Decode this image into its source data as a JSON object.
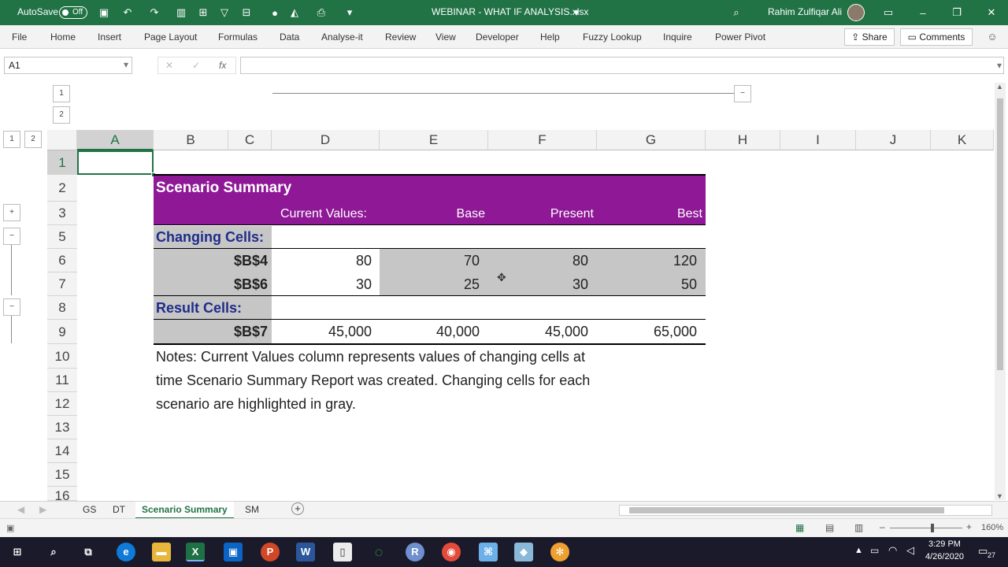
{
  "titlebar": {
    "autosave_label": "AutoSave",
    "autosave_state": "Off",
    "file_name": "WEBINAR - WHAT IF ANALYSIS.xlsx",
    "user_name": "Rahim Zulfiqar Ali"
  },
  "ribbon": {
    "tabs": [
      "File",
      "Home",
      "Insert",
      "Page Layout",
      "Formulas",
      "Data",
      "Analyse-it",
      "Review",
      "View",
      "Developer",
      "Help",
      "Fuzzy Lookup",
      "Inquire",
      "Power Pivot"
    ],
    "share": "Share",
    "comments": "Comments"
  },
  "formula_bar": {
    "name_box": "A1",
    "fx": "fx",
    "formula": ""
  },
  "outline": {
    "row_levels": [
      "1",
      "2"
    ],
    "col_levels": [
      "1",
      "2"
    ],
    "collapse_symbol": "−",
    "expand_symbol": "+"
  },
  "grid": {
    "columns": [
      "A",
      "B",
      "C",
      "D",
      "E",
      "F",
      "G",
      "H",
      "I",
      "J",
      "K"
    ],
    "rows": [
      "1",
      "2",
      "3",
      "5",
      "6",
      "7",
      "8",
      "9",
      "10",
      "11",
      "12",
      "13",
      "14",
      "15",
      "16"
    ]
  },
  "report": {
    "title": "Scenario Summary",
    "header_current": "Current Values:",
    "header_base": "Base",
    "header_present": "Present",
    "header_best": "Best",
    "changing_label": "Changing Cells:",
    "result_label": "Result Cells:",
    "row_b4": {
      "name": "$B$4",
      "current": "80",
      "base": "70",
      "present": "80",
      "best": "120"
    },
    "row_b6": {
      "name": "$B$6",
      "current": "30",
      "base": "25",
      "present": "30",
      "best": "50"
    },
    "row_b7": {
      "name": "$B$7",
      "current": "45,000",
      "base": "40,000",
      "present": "45,000",
      "best": "65,000"
    },
    "notes_line1": "Notes:  Current Values column represents values of changing cells at",
    "notes_line2": "time Scenario Summary Report was created.  Changing cells for each",
    "notes_line3": "scenario are highlighted in gray."
  },
  "sheet_tabs": [
    "GS",
    "DT",
    "Scenario Summary",
    "SM"
  ],
  "status": {
    "zoom": "160%"
  },
  "taskbar": {
    "time": "3:29 PM",
    "date": "4/26/2020",
    "notification_count": "27"
  }
}
